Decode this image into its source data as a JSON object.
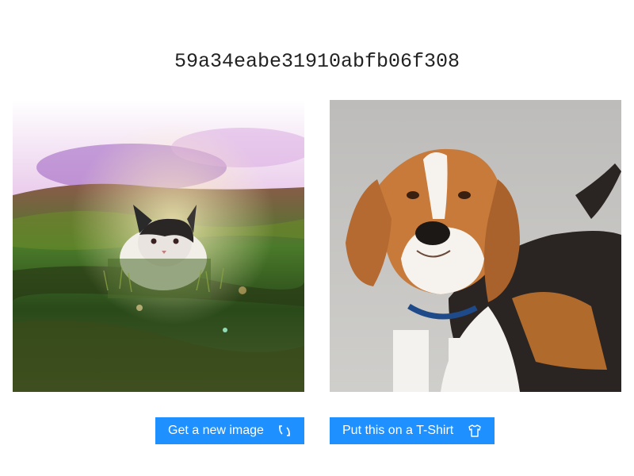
{
  "hash_title": "59a34eabe31910abfb06f308",
  "images": {
    "left": {
      "subject": "kitten-in-grass"
    },
    "right": {
      "subject": "beagle-dog"
    }
  },
  "buttons": {
    "new_image": {
      "label": "Get a new image",
      "icon": "refresh-icon"
    },
    "tshirt": {
      "label": "Put this on a T-Shirt",
      "icon": "tshirt-icon"
    }
  },
  "colors": {
    "button_bg": "#1e90ff",
    "button_text": "#ffffff",
    "title_text": "#222222"
  }
}
